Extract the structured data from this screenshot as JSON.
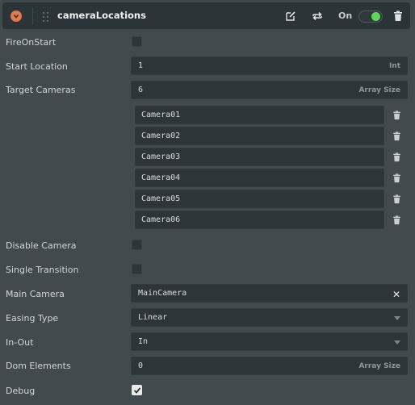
{
  "header": {
    "title": "cameraLocations",
    "collapse_icon": "chevron-down-circle-icon",
    "grip_icon": "drag-grip-icon",
    "edit_icon": "edit-icon",
    "swap_icon": "swap-icon",
    "on_label": "On",
    "toggle_on": true,
    "delete_icon": "trash-icon",
    "accent_color": "#e8774a",
    "toggle_color": "#60d45c"
  },
  "fields": {
    "fire_on_start": {
      "label": "FireOnStart",
      "checked": false
    },
    "start_location": {
      "label": "Start Location",
      "value": "1",
      "suffix": "Int"
    },
    "target_cameras": {
      "label": "Target Cameras",
      "value": "6",
      "suffix": "Array Size",
      "items": [
        "Camera01",
        "Camera02",
        "Camera03",
        "Camera04",
        "Camera05",
        "Camera06"
      ]
    },
    "disable_camera": {
      "label": "Disable Camera",
      "checked": false
    },
    "single_transition": {
      "label": "Single Transition",
      "checked": false
    },
    "main_camera": {
      "label": "Main Camera",
      "value": "MainCamera",
      "clear_icon": "close-icon"
    },
    "easing_type": {
      "label": "Easing Type",
      "value": "Linear"
    },
    "in_out": {
      "label": "In-Out",
      "value": "In"
    },
    "dom_elements": {
      "label": "Dom Elements",
      "value": "0",
      "suffix": "Array Size"
    },
    "debug": {
      "label": "Debug",
      "checked": true
    }
  }
}
